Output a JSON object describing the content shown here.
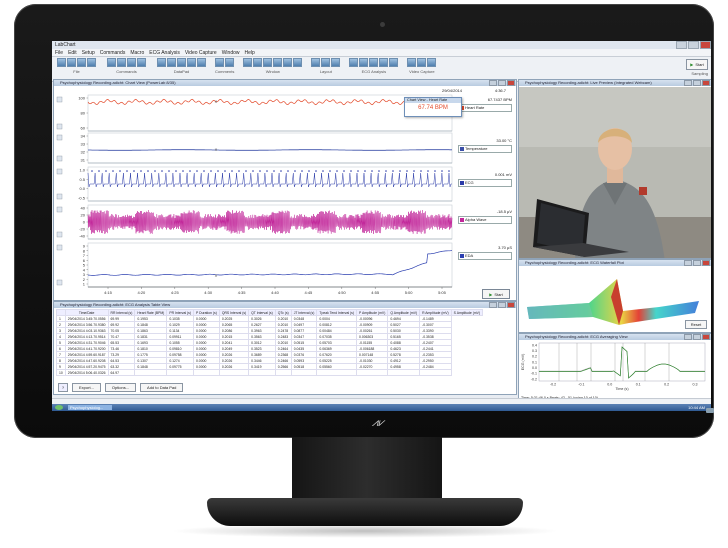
{
  "app": {
    "title": "LabChart",
    "menu": [
      "File",
      "Edit",
      "Setup",
      "Commands",
      "Macro",
      "ECG Analysis",
      "Video Capture",
      "Window",
      "Help"
    ],
    "toolbar_groups": [
      "File",
      "Commands",
      "DataPad",
      "Comments",
      "Window",
      "Layout",
      "ECG Analysis",
      "Video Capture"
    ],
    "start_label": "Start",
    "sampling_label": "Sampling"
  },
  "chart_view": {
    "title": "Psychophysiology Recording.adicht: Chart View (PowerLab 8/35)",
    "date": "29/04/2014",
    "popup_title": "Chart View - Heart Rate",
    "popup_value": "67.74 BPM",
    "start_button": "Start",
    "x_ticks": [
      "4:15",
      "4:20",
      "4:25",
      "4:30",
      "4:35",
      "4:40",
      "4:45",
      "4:50",
      "4:55",
      "5:00",
      "5:05"
    ],
    "channels": [
      {
        "name": "Heart Rate",
        "value": "67.7437 BPM",
        "color": "#e34b2c",
        "ticks": [
          "100",
          "80",
          "60"
        ]
      },
      {
        "name": "Temperature",
        "value": "33.00 °C",
        "color": "#3a4fa8",
        "ticks": [
          "34",
          "33",
          "32",
          "31"
        ]
      },
      {
        "name": "ECG",
        "value": "0.001 mV",
        "color": "#2a3aa8",
        "ticks": [
          "1.0",
          "0.5",
          "0.0",
          "-0.5"
        ]
      },
      {
        "name": "Alpha Wave",
        "value": "-18.5 µV",
        "color": "#c2269a",
        "ticks": [
          "40",
          "20",
          "0",
          "-20",
          "-40"
        ]
      },
      {
        "name": "EDA",
        "value": "3.70 µS",
        "color": "#2b3fb0",
        "ticks": [
          "9",
          "8",
          "7",
          "6",
          "5",
          "4",
          "3",
          "2",
          "1"
        ]
      }
    ],
    "channel_header_value": "4:36.7"
  },
  "table_view": {
    "title": "Psychophysiology Recording.adicht: ECG Analysis Table View",
    "columns": [
      "",
      "Time/Date",
      "RR Interval (s)",
      "Heart Rate (BPM)",
      "PR Interval (s)",
      "P Duration (s)",
      "QRS Interval (s)",
      "QT Interval (s)",
      "QTc (s)",
      "JT Interval (s)",
      "Tpeak Tend Interval (s)",
      "P Amplitude (mV)",
      "Q Amplitude (mV)",
      "R Amplitude (mV)",
      "S Amplitude (mV)"
    ],
    "rows": [
      [
        "1",
        "29/04/2014 3:45:70.0556",
        "69.99",
        "0.1953",
        "0.1035",
        "0.0000",
        "0.2025",
        "0.3026",
        "0.2010",
        "0.0348",
        "0.0004",
        "-0.00096",
        "0.4694",
        "-0.1489"
      ],
      [
        "2",
        "29/04/2014 3:56.70.9380",
        "69.92",
        "0.1848",
        "0.1029",
        "0.0000",
        "0.2065",
        "0.2627",
        "0.2010",
        "0.0497",
        "0.00812",
        "-0.00909",
        "0.5027",
        "-0.3007"
      ],
      [
        "3",
        "29/04/2014 4:03.10.9363",
        "70.05",
        "0.1863",
        "0.1134",
        "0.0000",
        "0.2086",
        "0.3963",
        "0.2478",
        "0.0877",
        "0.00484",
        "-0.00261",
        "0.5030",
        "-0.3390"
      ],
      [
        "4",
        "29/04/2014 4:13.70.9514",
        "70.47",
        "0.1831",
        "0.09911",
        "0.0000",
        "0.2015",
        "0.3563",
        "0.2483",
        "0.0347",
        "0.07035",
        "0.006303",
        "0.5165",
        "-0.3538"
      ],
      [
        "5",
        "29/04/2014 4:31.70.9046",
        "65.53",
        "0.1693",
        "0.1055",
        "0.0000",
        "0.2041",
        "0.3012",
        "0.2010",
        "0.0515",
        "0.05703",
        "-0.01155",
        "0.4088",
        "-0.2407"
      ],
      [
        "6",
        "29/04/2014 4:41.70.9200",
        "73.46",
        "0.1810",
        "0.09810",
        "0.0000",
        "0.2049",
        "0.3523",
        "0.2464",
        "0.0435",
        "0.06369",
        "-0.006188",
        "0.4623",
        "-0.2441"
      ],
      [
        "7",
        "29/04/2014 4:59.60.9187",
        "73.29",
        "0.1775",
        "0.09758",
        "0.0000",
        "0.2026",
        "0.3689",
        "0.2368",
        "0.0376",
        "0.07620",
        "0.007148",
        "0.5278",
        "-0.2353"
      ],
      [
        "8",
        "29/04/2014 4:47.60.9208",
        "64.53",
        "0.1307",
        "0.1274",
        "0.0000",
        "0.2026",
        "0.3446",
        "0.2466",
        "0.0593",
        "0.05225",
        "-0.01030",
        "0.4912",
        "-0.2950"
      ],
      [
        "9",
        "29/04/2014 4:57.20.9475",
        "63.32",
        "0.1848",
        "0.09775",
        "0.0000",
        "0.2026",
        "0.3419",
        "0.2566",
        "0.0518",
        "0.05560",
        "-0.02270",
        "0.4958",
        "-0.2484"
      ],
      [
        "10",
        "29/04/2014 5:06.40.0326",
        "64.97",
        "",
        "",
        "",
        "",
        "",
        "",
        "",
        "",
        "",
        "",
        ""
      ]
    ],
    "buttons": [
      "Export...",
      "Options...",
      "Add to Data Pad"
    ]
  },
  "webcam_view": {
    "title": "Psychophysiology Recording.adicht: Live Preview (Integrated Webcam)"
  },
  "waterfall_view": {
    "title": "Psychophysiology Recording.adicht: ECG Waterfall Plot",
    "reset_label": "Reset"
  },
  "averaging_view": {
    "title": "Psychophysiology Recording.adicht: ECG Averaging View",
    "y_ticks": [
      "0.4",
      "0.3",
      "0.2",
      "0.1",
      "0.0",
      "-0.1",
      "-0.2"
    ],
    "x_ticks": [
      "-0.2",
      "-0.1",
      "0.0",
      "0.1",
      "0.2",
      "0.3"
    ],
    "ylabel": "ECG (mV)",
    "xlabel": "Time (s)",
    "status": "Time: 5:31:46.0 s  Beats: 42 - 51  (using 10 of 10)"
  },
  "taskbar": {
    "task": "Psychophysiolog...",
    "clock": "10:44 AM"
  },
  "colors": {
    "heart_rate": "#e34b2c",
    "temperature": "#3a4fa8",
    "ecg": "#2a3aa8",
    "alpha": "#c2269a",
    "eda": "#2b3fb0"
  }
}
